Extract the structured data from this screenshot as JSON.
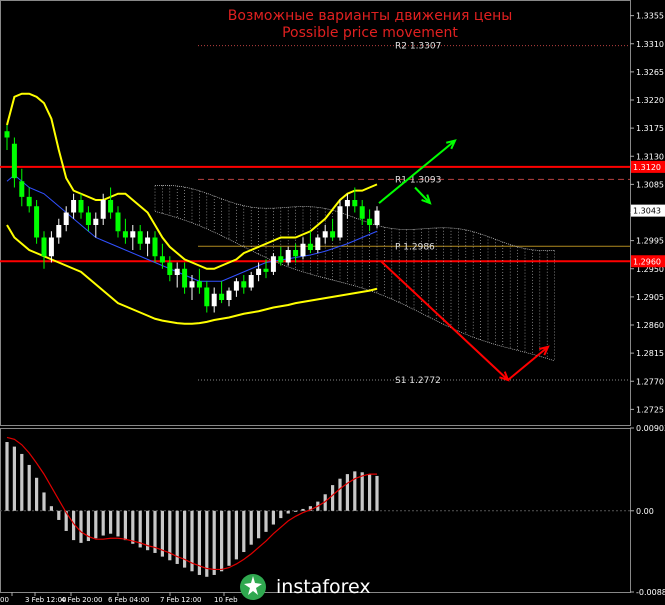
{
  "chart_data": [
    {
      "type": "line",
      "title": "Возможные варианты движения цены",
      "subtitle": "Possible price movement",
      "ylim": [
        1.27,
        1.338
      ],
      "y_ticks": [
        "1.3355",
        "1.3310",
        "1.3265",
        "1.3220",
        "1.3175",
        "1.3130",
        "1.3085",
        "1.3040",
        "1.2995",
        "1.2950",
        "1.2905",
        "1.2860",
        "1.2815",
        "1.2770",
        "1.2725"
      ],
      "x_ticks": [
        "00",
        "3 Feb 12:00",
        "4 Feb 20:00",
        "6 Feb 04:00",
        "7 Feb 12:00",
        "10 Feb"
      ],
      "price_labels": [
        {
          "text": "1.3120",
          "value": 1.3113,
          "color": "#ff0000"
        },
        {
          "text": "1.3043",
          "value": 1.3043,
          "color": "#ffffff"
        },
        {
          "text": "1.2960",
          "value": 1.2962,
          "color": "#ff0000"
        }
      ],
      "levels": [
        {
          "name": "R2",
          "label": "R2 1.3307",
          "value": 1.3307,
          "style": "dotted",
          "color": "#b84040"
        },
        {
          "name": "R1",
          "label": "R1 1.3093",
          "value": 1.3093,
          "style": "dashed",
          "color": "#b84040"
        },
        {
          "name": "P",
          "label": "P 1.2986",
          "value": 1.2986,
          "style": "solid",
          "color": "#b08a20"
        },
        {
          "name": "S1",
          "label": "S1 1.2772",
          "value": 1.2772,
          "style": "dotted",
          "color": "#888888"
        }
      ],
      "resistance_lines": [
        1.3113,
        1.2962
      ],
      "arrows": {
        "green_up_target": 1.3155,
        "green_down_target": 1.3055,
        "red_low": 1.2772,
        "red_rebound": 1.2825
      },
      "candles": [
        [
          1.317,
          1.318,
          1.314,
          1.316
        ],
        [
          1.315,
          1.316,
          1.308,
          1.3095
        ],
        [
          1.309,
          1.311,
          1.305,
          1.3065
        ],
        [
          1.3065,
          1.308,
          1.304,
          1.305
        ],
        [
          1.305,
          1.306,
          1.299,
          1.3
        ],
        [
          1.3,
          1.301,
          1.295,
          1.297
        ],
        [
          1.297,
          1.301,
          1.296,
          1.3
        ],
        [
          1.3,
          1.303,
          1.299,
          1.302
        ],
        [
          1.302,
          1.305,
          1.301,
          1.304
        ],
        [
          1.304,
          1.307,
          1.303,
          1.306
        ],
        [
          1.306,
          1.307,
          1.303,
          1.304
        ],
        [
          1.304,
          1.305,
          1.301,
          1.302
        ],
        [
          1.302,
          1.304,
          1.3,
          1.303
        ],
        [
          1.303,
          1.307,
          1.302,
          1.306
        ],
        [
          1.306,
          1.308,
          1.303,
          1.304
        ],
        [
          1.304,
          1.305,
          1.3,
          1.301
        ],
        [
          1.301,
          1.303,
          1.299,
          1.3
        ],
        [
          1.3,
          1.302,
          1.298,
          1.301
        ],
        [
          1.301,
          1.302,
          1.298,
          1.299
        ],
        [
          1.299,
          1.301,
          1.297,
          1.3
        ],
        [
          1.3,
          1.301,
          1.296,
          1.297
        ],
        [
          1.297,
          1.299,
          1.295,
          1.296
        ],
        [
          1.296,
          1.297,
          1.293,
          1.294
        ],
        [
          1.294,
          1.296,
          1.292,
          1.295
        ],
        [
          1.295,
          1.296,
          1.291,
          1.292
        ],
        [
          1.292,
          1.294,
          1.29,
          1.293
        ],
        [
          1.293,
          1.295,
          1.291,
          1.292
        ],
        [
          1.292,
          1.293,
          1.288,
          1.289
        ],
        [
          1.289,
          1.292,
          1.288,
          1.291
        ],
        [
          1.291,
          1.293,
          1.2895,
          1.29
        ],
        [
          1.29,
          1.292,
          1.289,
          1.2915
        ],
        [
          1.2915,
          1.2935,
          1.2905,
          1.293
        ],
        [
          1.293,
          1.294,
          1.291,
          1.292
        ],
        [
          1.292,
          1.2945,
          1.2915,
          1.294
        ],
        [
          1.294,
          1.296,
          1.293,
          1.295
        ],
        [
          1.295,
          1.2965,
          1.2935,
          1.2945
        ],
        [
          1.2945,
          1.2975,
          1.294,
          1.297
        ],
        [
          1.297,
          1.2985,
          1.2955,
          1.296
        ],
        [
          1.296,
          1.2985,
          1.2955,
          1.298
        ],
        [
          1.298,
          1.299,
          1.296,
          1.297
        ],
        [
          1.297,
          1.3,
          1.2965,
          1.299
        ],
        [
          1.299,
          1.301,
          1.2975,
          1.298
        ],
        [
          1.298,
          1.3005,
          1.2975,
          1.3
        ],
        [
          1.3,
          1.302,
          1.299,
          1.301
        ],
        [
          1.301,
          1.303,
          1.2995,
          1.3
        ],
        [
          1.3,
          1.306,
          1.2995,
          1.305
        ],
        [
          1.305,
          1.307,
          1.303,
          1.306
        ],
        [
          1.306,
          1.308,
          1.304,
          1.305
        ],
        [
          1.305,
          1.306,
          1.302,
          1.303
        ],
        [
          1.303,
          1.3045,
          1.301,
          1.302
        ],
        [
          1.302,
          1.305,
          1.3015,
          1.3043
        ]
      ],
      "bb_upper": [
        1.318,
        1.3225,
        1.323,
        1.323,
        1.3225,
        1.3215,
        1.319,
        1.314,
        1.3095,
        1.3075,
        1.307,
        1.3065,
        1.306,
        1.306,
        1.3065,
        1.307,
        1.307,
        1.306,
        1.305,
        1.304,
        1.302,
        1.3,
        1.2985,
        1.2975,
        1.2965,
        1.296,
        1.2955,
        1.295,
        1.295,
        1.2955,
        1.296,
        1.2965,
        1.2975,
        1.298,
        1.2985,
        1.299,
        1.2995,
        1.3,
        1.3,
        1.3,
        1.3005,
        1.301,
        1.302,
        1.303,
        1.3045,
        1.306,
        1.307,
        1.3075,
        1.3075,
        1.308,
        1.3085
      ],
      "bb_mid": [
        1.309,
        1.31,
        1.309,
        1.308,
        1.3075,
        1.307,
        1.306,
        1.305,
        1.304,
        1.303,
        1.302,
        1.301,
        1.3,
        1.2995,
        1.299,
        1.2985,
        1.298,
        1.2975,
        1.297,
        1.2965,
        1.296,
        1.2955,
        1.295,
        1.2945,
        1.294,
        1.2935,
        1.293,
        1.293,
        1.293,
        1.293,
        1.2935,
        1.294,
        1.2945,
        1.295,
        1.2955,
        1.296,
        1.2962,
        1.2964,
        1.2966,
        1.2968,
        1.297,
        1.2972,
        1.2975,
        1.2978,
        1.2982,
        1.2986,
        1.299,
        1.2995,
        1.3,
        1.3005,
        1.301
      ],
      "bb_lower": [
        1.302,
        1.3,
        1.299,
        1.298,
        1.2975,
        1.297,
        1.2965,
        1.296,
        1.2955,
        1.295,
        1.2945,
        1.2935,
        1.2925,
        1.2915,
        1.2905,
        1.2895,
        1.289,
        1.2885,
        1.288,
        1.2875,
        1.287,
        1.2867,
        1.2865,
        1.2863,
        1.2862,
        1.2862,
        1.2863,
        1.2865,
        1.2868,
        1.287,
        1.2872,
        1.2875,
        1.2878,
        1.288,
        1.2882,
        1.2885,
        1.2888,
        1.289,
        1.2892,
        1.2895,
        1.2897,
        1.2899,
        1.2901,
        1.2903,
        1.2905,
        1.2907,
        1.2909,
        1.2911,
        1.2913,
        1.2915,
        1.2918
      ],
      "macd_hist": [
        0.0075,
        0.007,
        0.0062,
        0.005,
        0.0036,
        0.002,
        0.0005,
        -0.001,
        -0.0022,
        -0.0032,
        -0.0035,
        -0.0033,
        -0.003,
        -0.0027,
        -0.0025,
        -0.0028,
        -0.0032,
        -0.0036,
        -0.004,
        -0.0043,
        -0.0046,
        -0.005,
        -0.0054,
        -0.0058,
        -0.0062,
        -0.0066,
        -0.007,
        -0.0072,
        -0.007,
        -0.0066,
        -0.006,
        -0.0053,
        -0.0045,
        -0.0037,
        -0.003,
        -0.0023,
        -0.0015,
        -0.0008,
        -0.0003,
        0.0,
        0.0002,
        0.0005,
        0.001,
        0.0018,
        0.0028,
        0.0035,
        0.004,
        0.0043,
        0.0042,
        0.004,
        0.0038
      ],
      "macd_signal": [
        0.008,
        0.0078,
        0.0072,
        0.0063,
        0.0052,
        0.004,
        0.0026,
        0.0012,
        -0.0002,
        -0.0014,
        -0.0023,
        -0.0028,
        -0.0031,
        -0.0031,
        -0.003,
        -0.003,
        -0.0031,
        -0.0033,
        -0.0035,
        -0.0038,
        -0.004,
        -0.0043,
        -0.0046,
        -0.005,
        -0.0053,
        -0.0057,
        -0.006,
        -0.0063,
        -0.0064,
        -0.0064,
        -0.0062,
        -0.0058,
        -0.0053,
        -0.0047,
        -0.004,
        -0.0033,
        -0.0025,
        -0.0018,
        -0.0011,
        -0.0006,
        -0.0002,
        0.0001,
        0.0005,
        0.001,
        0.0017,
        0.0024,
        0.003,
        0.0035,
        0.0038,
        0.004,
        0.004
      ],
      "macd_ylim": [
        -0.00886,
        0.00903
      ],
      "macd_ticks": [
        "0.00903",
        "0.00",
        "-0.00886"
      ]
    }
  ],
  "watermark": {
    "brand": "instaforex"
  },
  "colors": {
    "bullish": "#ffffff",
    "bearish": "#00ff00",
    "bands": "#ffff00",
    "resistance": "#ff0000",
    "arrow_up": "#00ff00",
    "arrow_down": "#ff0000"
  }
}
